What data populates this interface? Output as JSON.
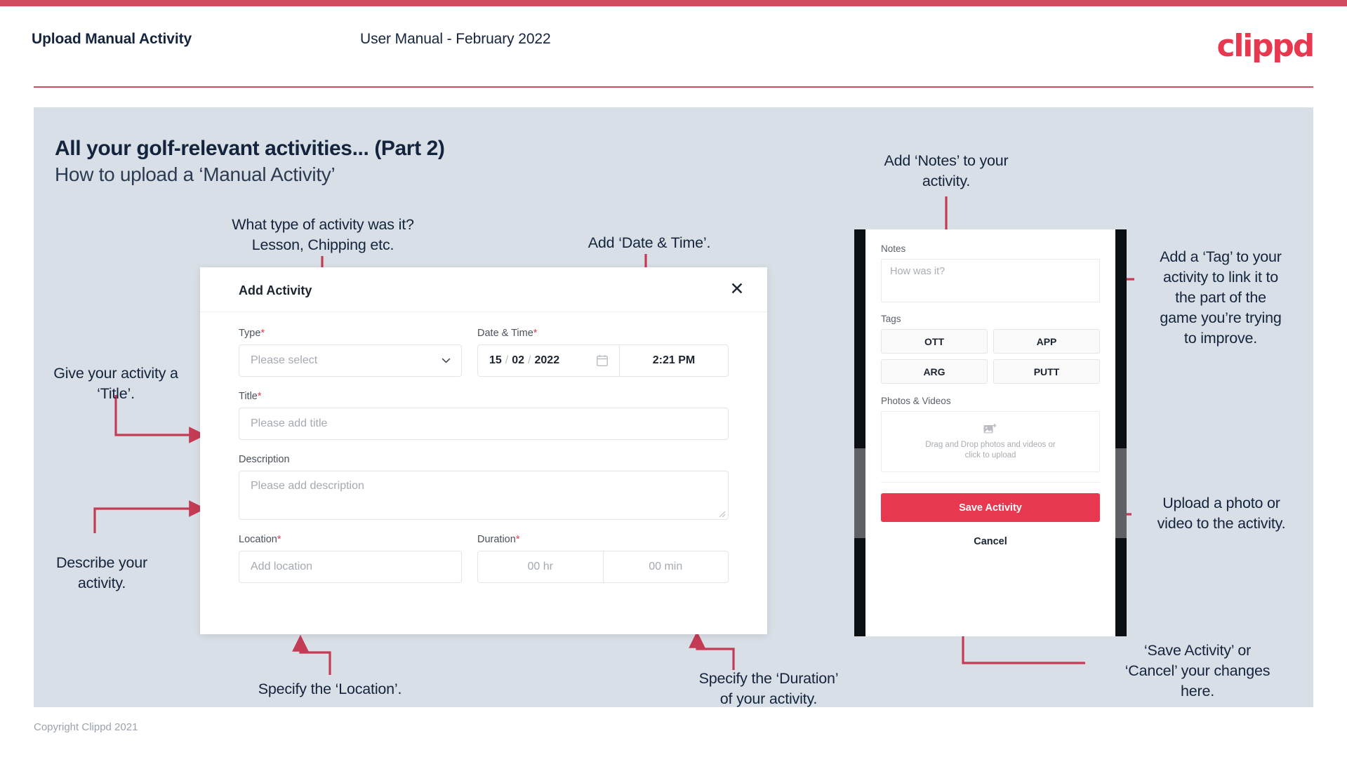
{
  "header": {
    "left_title": "Upload Manual Activity",
    "center_title": "User Manual - February 2022",
    "logo": "clippd"
  },
  "slide": {
    "title": "All your golf-relevant activities... (Part 2)",
    "subtitle": "How to upload a ‘Manual Activity’"
  },
  "footer": {
    "copyright": "Copyright Clippd 2021"
  },
  "annotations": {
    "type": "What type of activity was it?\nLesson, Chipping etc.",
    "date_time": "Add ‘Date & Time’.",
    "title": "Give your activity a\n‘Title’.",
    "description": "Describe your\nactivity.",
    "location": "Specify the ‘Location’.",
    "duration": "Specify the ‘Duration’\nof your activity.",
    "notes": "Add ‘Notes’ to your\nactivity.",
    "tags": "Add a ‘Tag’ to your\nactivity to link it to\nthe part of the\ngame you’re trying\nto improve.",
    "photos": "Upload a photo or\nvideo to the activity.",
    "save_cancel": "‘Save Activity’ or\n‘Cancel’ your changes\nhere."
  },
  "modal": {
    "title": "Add Activity",
    "close_label": "✕",
    "fields": {
      "type": {
        "label": "Type",
        "required": "*",
        "placeholder": "Please select"
      },
      "date_time": {
        "label": "Date & Time",
        "required": "*",
        "day": "15",
        "month": "02",
        "year": "2022",
        "separator": "/",
        "time": "2:21 PM"
      },
      "title": {
        "label": "Title",
        "required": "*",
        "placeholder": "Please add title"
      },
      "description": {
        "label": "Description",
        "required": "",
        "placeholder": "Please add description"
      },
      "location": {
        "label": "Location",
        "required": "*",
        "placeholder": "Add location"
      },
      "duration": {
        "label": "Duration",
        "required": "*",
        "hours_placeholder": "00 hr",
        "minutes_placeholder": "00 min"
      }
    }
  },
  "phone": {
    "notes": {
      "label": "Notes",
      "placeholder": "How was it?"
    },
    "tags": {
      "label": "Tags",
      "items": [
        "OTT",
        "APP",
        "ARG",
        "PUTT"
      ]
    },
    "photos": {
      "label": "Photos & Videos",
      "dropzone_line1": "Drag and Drop photos and videos or",
      "dropzone_line2": "click to upload"
    },
    "save_label": "Save Activity",
    "cancel_label": "Cancel"
  },
  "colors": {
    "brand_red": "#e8384f",
    "accent_bar": "#cf4d5f",
    "slide_bg": "#d9dfe6",
    "text_dark": "#14243d",
    "connector": "#c43b55"
  }
}
